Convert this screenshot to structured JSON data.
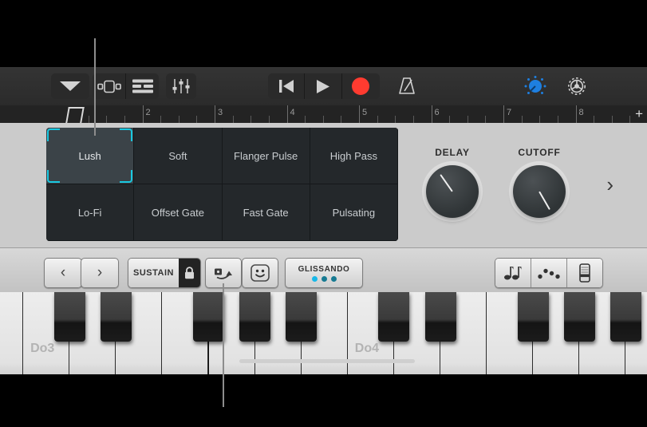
{
  "toolbar": {
    "menu_button": "chevron-down",
    "view_browser": "browser-view-icon",
    "view_tracks": "tracks-view-icon",
    "mixer": "mixer-sliders-icon",
    "rewind": "rewind-icon",
    "play": "play-icon",
    "record": "record-icon",
    "metronome": "metronome-icon",
    "fx_knob": "fx-knob-icon",
    "settings": "gear-icon",
    "record_color": "#ff3b30",
    "fx_color": "#1e7fe0"
  },
  "ruler": {
    "marks": [
      "2",
      "3",
      "4",
      "5",
      "6",
      "7",
      "8"
    ],
    "add_label": "+"
  },
  "presets": {
    "items": [
      {
        "label": "Lush",
        "selected": true
      },
      {
        "label": "Soft",
        "selected": false
      },
      {
        "label": "Flanger Pulse",
        "selected": false
      },
      {
        "label": "High Pass",
        "selected": false
      },
      {
        "label": "Lo-Fi",
        "selected": false
      },
      {
        "label": "Offset Gate",
        "selected": false
      },
      {
        "label": "Fast Gate",
        "selected": false
      },
      {
        "label": "Pulsating",
        "selected": false
      }
    ],
    "selection_color": "#19c8e0"
  },
  "knobs": [
    {
      "label": "DELAY",
      "angle": -35
    },
    {
      "label": "CUTOFF",
      "angle": 150
    }
  ],
  "panel_next": "›",
  "keyboard_bar": {
    "prev_octave": "‹",
    "next_octave": "›",
    "sustain_label": "SUSTAIN",
    "sustain_lock": "lock-icon",
    "arpeggiator": "arpeggiator-icon",
    "smiley": "smiley-face-icon",
    "glissando_label": "GLISSANDO",
    "glissando_dots": [
      "#18b8e8",
      "#177a92",
      "#177a92"
    ],
    "note_button": "eighth-notes-icon",
    "chord_button": "arpeggio-dots-icon",
    "fader_button": "fader-icon"
  },
  "piano": {
    "octave_labels": [
      "Do3",
      "Do4"
    ]
  }
}
